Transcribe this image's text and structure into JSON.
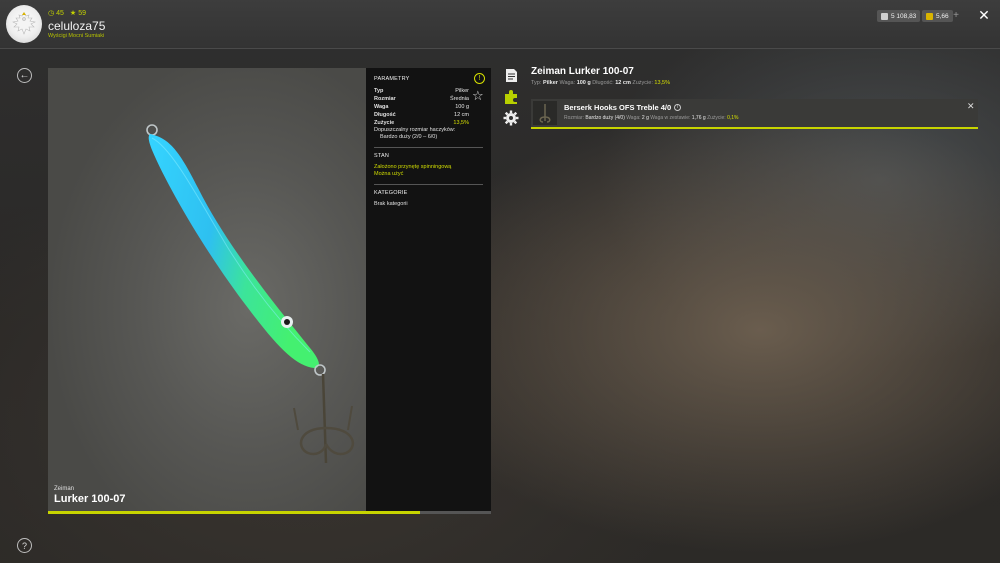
{
  "header": {
    "username": "celuloza75",
    "level": "45",
    "rank": "59",
    "subtitle": "Wyścigi Mocni Sumiaki",
    "silver": "5 108,83",
    "gold": "5,66",
    "plus_label": "+",
    "close_label": "✕"
  },
  "viewer": {
    "brand": "Zeiman",
    "name": "Lurker 100-07",
    "progress": 0.84
  },
  "info": {
    "params_title": "PARAMETRY",
    "params": [
      {
        "label": "Typ",
        "value": "Pilker",
        "highlight": false
      },
      {
        "label": "Rozmiar",
        "value": "Średnia",
        "highlight": false
      },
      {
        "label": "Waga",
        "value": "100 g",
        "highlight": false
      },
      {
        "label": "Długość",
        "value": "12 cm",
        "highlight": false
      },
      {
        "label": "Zużycie",
        "value": "13,5%",
        "highlight": true
      }
    ],
    "hook_label": "Dopuszczalny rozmiar haczyków:",
    "hook_value": "Bardzo duży (2/0 – 6/0)",
    "state_title": "STAN",
    "state_items": [
      "Założono przynętę spinningową",
      "Można użyć"
    ],
    "cat_title": "KATEGORIE",
    "cat_items": [
      "Brak kategorii"
    ]
  },
  "right": {
    "title": "Zeiman Lurker 100-07",
    "sub": {
      "typ_label": "Typ:",
      "typ": "Pilker",
      "waga_label": "Waga:",
      "waga": "100 g",
      "dlugosc_label": "Długość:",
      "dlugosc": "12 cm",
      "zuzycie_label": "Zużycie:",
      "zuzycie": "13,5%"
    },
    "component": {
      "name": "Berserk Hooks OFS Treble 4/0",
      "rozmiar_label": "Rozmiar:",
      "rozmiar": "Bardzo duży (4/0)",
      "waga_label": "Waga:",
      "waga": "2 g",
      "waga_zest_label": "Waga w zestawie:",
      "waga_zest": "1,76 g",
      "zuzycie_label": "Zużycie:",
      "zuzycie": "0,1%"
    }
  },
  "colors": {
    "accent": "#c7d400",
    "lure_top": "#2fc7ff",
    "lure_belly": "#3df06a"
  }
}
